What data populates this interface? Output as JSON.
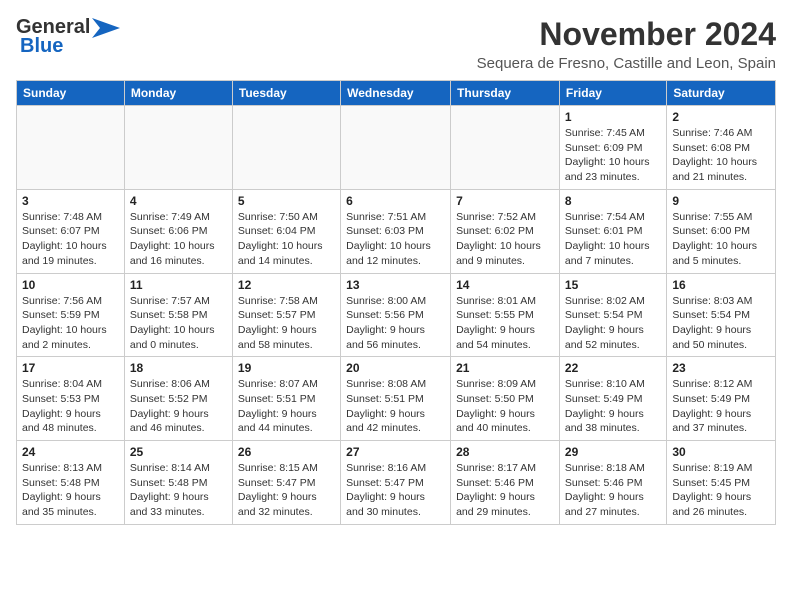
{
  "header": {
    "logo_line1": "General",
    "logo_line2": "Blue",
    "month": "November 2024",
    "subtitle": "Sequera de Fresno, Castille and Leon, Spain"
  },
  "weekdays": [
    "Sunday",
    "Monday",
    "Tuesday",
    "Wednesday",
    "Thursday",
    "Friday",
    "Saturday"
  ],
  "weeks": [
    [
      {
        "day": "",
        "info": ""
      },
      {
        "day": "",
        "info": ""
      },
      {
        "day": "",
        "info": ""
      },
      {
        "day": "",
        "info": ""
      },
      {
        "day": "",
        "info": ""
      },
      {
        "day": "1",
        "info": "Sunrise: 7:45 AM\nSunset: 6:09 PM\nDaylight: 10 hours and 23 minutes."
      },
      {
        "day": "2",
        "info": "Sunrise: 7:46 AM\nSunset: 6:08 PM\nDaylight: 10 hours and 21 minutes."
      }
    ],
    [
      {
        "day": "3",
        "info": "Sunrise: 7:48 AM\nSunset: 6:07 PM\nDaylight: 10 hours and 19 minutes."
      },
      {
        "day": "4",
        "info": "Sunrise: 7:49 AM\nSunset: 6:06 PM\nDaylight: 10 hours and 16 minutes."
      },
      {
        "day": "5",
        "info": "Sunrise: 7:50 AM\nSunset: 6:04 PM\nDaylight: 10 hours and 14 minutes."
      },
      {
        "day": "6",
        "info": "Sunrise: 7:51 AM\nSunset: 6:03 PM\nDaylight: 10 hours and 12 minutes."
      },
      {
        "day": "7",
        "info": "Sunrise: 7:52 AM\nSunset: 6:02 PM\nDaylight: 10 hours and 9 minutes."
      },
      {
        "day": "8",
        "info": "Sunrise: 7:54 AM\nSunset: 6:01 PM\nDaylight: 10 hours and 7 minutes."
      },
      {
        "day": "9",
        "info": "Sunrise: 7:55 AM\nSunset: 6:00 PM\nDaylight: 10 hours and 5 minutes."
      }
    ],
    [
      {
        "day": "10",
        "info": "Sunrise: 7:56 AM\nSunset: 5:59 PM\nDaylight: 10 hours and 2 minutes."
      },
      {
        "day": "11",
        "info": "Sunrise: 7:57 AM\nSunset: 5:58 PM\nDaylight: 10 hours and 0 minutes."
      },
      {
        "day": "12",
        "info": "Sunrise: 7:58 AM\nSunset: 5:57 PM\nDaylight: 9 hours and 58 minutes."
      },
      {
        "day": "13",
        "info": "Sunrise: 8:00 AM\nSunset: 5:56 PM\nDaylight: 9 hours and 56 minutes."
      },
      {
        "day": "14",
        "info": "Sunrise: 8:01 AM\nSunset: 5:55 PM\nDaylight: 9 hours and 54 minutes."
      },
      {
        "day": "15",
        "info": "Sunrise: 8:02 AM\nSunset: 5:54 PM\nDaylight: 9 hours and 52 minutes."
      },
      {
        "day": "16",
        "info": "Sunrise: 8:03 AM\nSunset: 5:54 PM\nDaylight: 9 hours and 50 minutes."
      }
    ],
    [
      {
        "day": "17",
        "info": "Sunrise: 8:04 AM\nSunset: 5:53 PM\nDaylight: 9 hours and 48 minutes."
      },
      {
        "day": "18",
        "info": "Sunrise: 8:06 AM\nSunset: 5:52 PM\nDaylight: 9 hours and 46 minutes."
      },
      {
        "day": "19",
        "info": "Sunrise: 8:07 AM\nSunset: 5:51 PM\nDaylight: 9 hours and 44 minutes."
      },
      {
        "day": "20",
        "info": "Sunrise: 8:08 AM\nSunset: 5:51 PM\nDaylight: 9 hours and 42 minutes."
      },
      {
        "day": "21",
        "info": "Sunrise: 8:09 AM\nSunset: 5:50 PM\nDaylight: 9 hours and 40 minutes."
      },
      {
        "day": "22",
        "info": "Sunrise: 8:10 AM\nSunset: 5:49 PM\nDaylight: 9 hours and 38 minutes."
      },
      {
        "day": "23",
        "info": "Sunrise: 8:12 AM\nSunset: 5:49 PM\nDaylight: 9 hours and 37 minutes."
      }
    ],
    [
      {
        "day": "24",
        "info": "Sunrise: 8:13 AM\nSunset: 5:48 PM\nDaylight: 9 hours and 35 minutes."
      },
      {
        "day": "25",
        "info": "Sunrise: 8:14 AM\nSunset: 5:48 PM\nDaylight: 9 hours and 33 minutes."
      },
      {
        "day": "26",
        "info": "Sunrise: 8:15 AM\nSunset: 5:47 PM\nDaylight: 9 hours and 32 minutes."
      },
      {
        "day": "27",
        "info": "Sunrise: 8:16 AM\nSunset: 5:47 PM\nDaylight: 9 hours and 30 minutes."
      },
      {
        "day": "28",
        "info": "Sunrise: 8:17 AM\nSunset: 5:46 PM\nDaylight: 9 hours and 29 minutes."
      },
      {
        "day": "29",
        "info": "Sunrise: 8:18 AM\nSunset: 5:46 PM\nDaylight: 9 hours and 27 minutes."
      },
      {
        "day": "30",
        "info": "Sunrise: 8:19 AM\nSunset: 5:45 PM\nDaylight: 9 hours and 26 minutes."
      }
    ]
  ]
}
